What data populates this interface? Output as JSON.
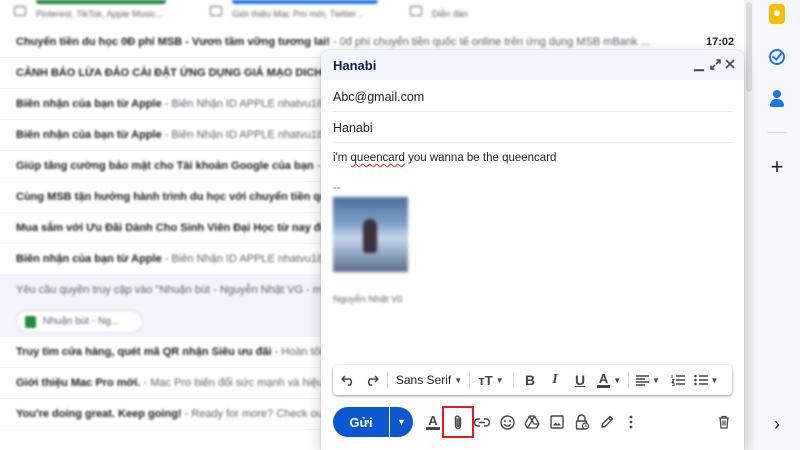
{
  "inbox": {
    "categories": [
      {
        "text": "Pinterest, TikTok, Apple Music...",
        "color": "#188038"
      },
      {
        "text": "Giới thiệu Mac Pro mới, Twitter...",
        "color": "#1a73e8"
      },
      {
        "text": "Diễn đàn",
        "color": "#5f6368"
      }
    ],
    "rows": [
      {
        "sender": "Chuyển tiền du học 0Đ phí MSB - Vươn tầm vững tương lai!",
        "snippet": " - 0đ phí chuyển tiền quốc tế online trên ứng dụng MSB mBank ...",
        "time": "17:02"
      },
      {
        "sender": "CẢNH BÁO LỪA ĐẢO CÀI ĐẶT ỨNG DỤNG GIẢ MẠO DICH",
        "snippet": "",
        "time": ""
      },
      {
        "sender": "Biên nhận của bạn từ Apple",
        "snippet": " - Biên Nhận ID APPLE nhatvu181...",
        "time": ""
      },
      {
        "sender": "Biên nhận của bạn từ Apple",
        "snippet": " - Biên Nhận ID APPLE nhatvu181...",
        "time": ""
      },
      {
        "sender": "Giúp tăng cường bảo mật cho Tài khoản Google của bạn",
        "snippet": " - ...",
        "time": ""
      },
      {
        "sender": "Cùng MSB tận hưởng hành trình du học với chuyển tiền quốc",
        "snippet": "",
        "time": ""
      },
      {
        "sender": "Mua sắm với Ưu Đãi Dành Cho Sinh Viên Đại Học từ nay đế",
        "snippet": "",
        "time": ""
      },
      {
        "sender": "Biên nhận của bạn từ Apple",
        "snippet": " - Biên Nhận ID APPLE nhatvu181...",
        "time": ""
      },
      {
        "sender": "Yêu cầu quyền truy cập vào \"Nhuận bút - Nguyễn Nhật VG - m",
        "snippet": "",
        "time": ""
      },
      {
        "sender": "Truy tìm cửa hàng, quét mã QR nhận Siêu ưu đãi",
        "snippet": " - Hoàn tốt",
        "time": ""
      },
      {
        "sender": "Giới thiệu Mac Pro mới.",
        "snippet": " - Mac Pro biến đổi sức mạnh và hiệu",
        "time": ""
      },
      {
        "sender": "You're doing great. Keep going!",
        "snippet": " - Ready for more? Check ou",
        "time": ""
      }
    ],
    "chip_label": "Nhuận bút - Ng..."
  },
  "compose": {
    "title": "Hanabi",
    "to": "Abc@gmail.com",
    "subject": "Hanabi",
    "body_before": "i'm ",
    "body_misspelled": "queencard",
    "body_after": " you wanna be the queencard",
    "signature_dash": "--",
    "signature_name": "Nguyễn Nhật Vũ",
    "font_name": "Sans Serif",
    "send_label": "Gửi"
  },
  "icons": {
    "minimize": "minimize-icon",
    "expand": "expand-icon",
    "close": "close-icon",
    "attach": "paperclip-icon"
  },
  "colors": {
    "send_button": "#0b57d0",
    "highlight_box": "#e01e1e",
    "header_bg": "#f2f6fc"
  }
}
